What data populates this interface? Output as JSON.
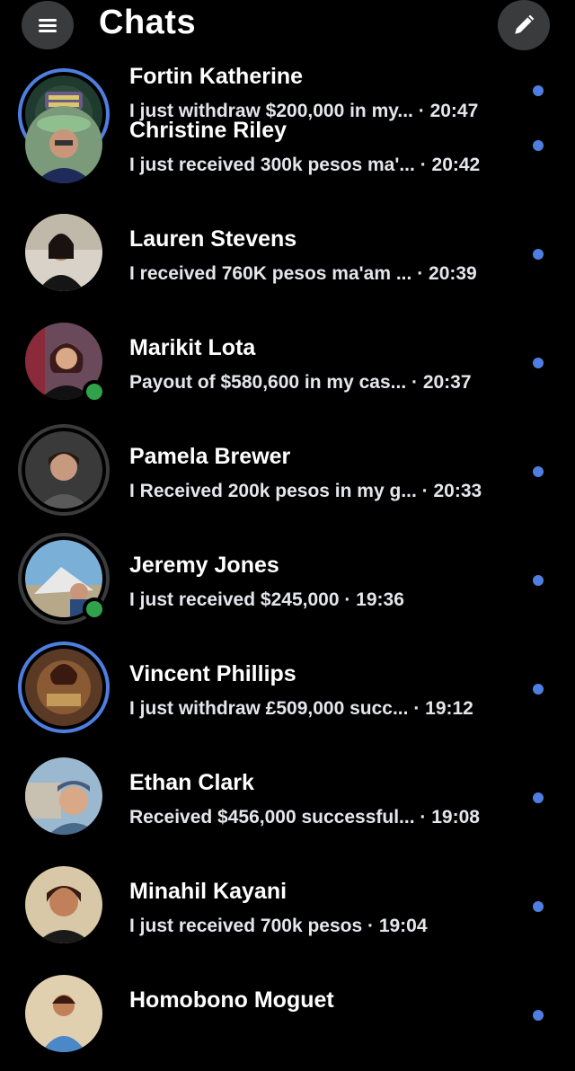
{
  "header": {
    "title": "Chats",
    "menu_icon": "hamburger-icon",
    "compose_icon": "pencil-icon"
  },
  "colors": {
    "background": "#000000",
    "unread_dot": "#4e7fe0",
    "online": "#31a24c",
    "button_bg": "#3a3b3c"
  },
  "chats": [
    {
      "name": "Fortin Katherine",
      "message": "I just withdraw $200,000 in my...",
      "time": "· 20:47",
      "online": false,
      "ring": "blue",
      "unread": true
    },
    {
      "name": "Christine Riley",
      "message": "I just received 300k pesos ma'...",
      "time": "· 20:42",
      "online": false,
      "ring": "none",
      "unread": true
    },
    {
      "name": "Lauren Stevens",
      "message": "I received 760K pesos ma'am ...",
      "time": "· 20:39",
      "online": false,
      "ring": "none",
      "unread": true
    },
    {
      "name": "Marikit Lota",
      "message": "Payout of $580,600 in my cas...",
      "time": "· 20:37",
      "online": true,
      "ring": "none",
      "unread": true
    },
    {
      "name": "Pamela Brewer",
      "message": "I Received 200k pesos in my g...",
      "time": "· 20:33",
      "online": false,
      "ring": "grey",
      "unread": true
    },
    {
      "name": "Jeremy Jones",
      "message": "I just received $245,000",
      "time": "· 19:36",
      "online": true,
      "ring": "grey",
      "unread": true
    },
    {
      "name": "Vincent Phillips",
      "message": "I just withdraw £509,000 succ...",
      "time": "· 19:12",
      "online": false,
      "ring": "blue",
      "unread": true
    },
    {
      "name": "Ethan Clark",
      "message": "Received $456,000 successful...",
      "time": "· 19:08",
      "online": false,
      "ring": "none",
      "unread": true
    },
    {
      "name": "Minahil Kayani",
      "message": "I just received 700k pesos",
      "time": "· 19:04",
      "online": false,
      "ring": "none",
      "unread": true
    },
    {
      "name": "Homobono Moguet",
      "message": "",
      "time": "",
      "online": false,
      "ring": "none",
      "unread": true
    }
  ]
}
